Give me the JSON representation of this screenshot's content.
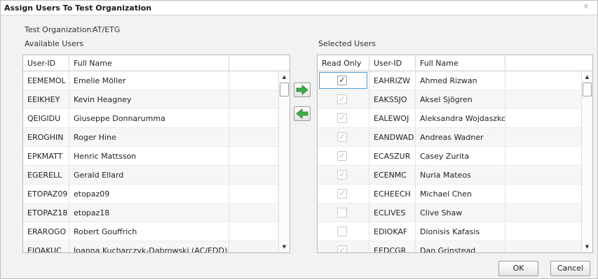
{
  "dialog": {
    "title": "Assign Users To Test Organization",
    "close_glyph": "⨯",
    "org_label": "Test Organization:",
    "org_value": "AT/ETG",
    "available_label": "Available Users",
    "selected_label": "Selected Users"
  },
  "available": {
    "columns": [
      "User-ID",
      "Full Name"
    ],
    "rows": [
      {
        "id": "EEMEMOL",
        "name": "Emelie Möller"
      },
      {
        "id": "EEIKHEY",
        "name": "Kevin Heagney"
      },
      {
        "id": "QEIGIDU",
        "name": "Giuseppe Donnarumma"
      },
      {
        "id": "EROGHIN",
        "name": "Roger Hine"
      },
      {
        "id": "EPKMATT",
        "name": "Henric Mattsson"
      },
      {
        "id": "EGERELL",
        "name": "Gerald Ellard"
      },
      {
        "id": "ETOPAZ09",
        "name": "etopaz09"
      },
      {
        "id": "ETOPAZ18",
        "name": "etopaz18"
      },
      {
        "id": "ERAROGO",
        "name": "Robert Gouffrich"
      },
      {
        "id": "EJOAKUC",
        "name": "Joanna Kucharczyk-Dabrowski (AC/EDD)"
      }
    ]
  },
  "selected": {
    "columns": [
      "Read Only",
      "User-ID",
      "Full Name"
    ],
    "rows": [
      {
        "id": "EAHRIZW",
        "name": "Ahmed Rizwan",
        "read_only": true
      },
      {
        "id": "EAKSSJO",
        "name": "Aksel Sjögren",
        "read_only": true
      },
      {
        "id": "EALEWOJ",
        "name": "Aleksandra Wojdaszko",
        "read_only": true
      },
      {
        "id": "EANDWAD",
        "name": "Andreas Wadner",
        "read_only": true
      },
      {
        "id": "ECASZUR",
        "name": "Casey Zurita",
        "read_only": true
      },
      {
        "id": "ECENMC",
        "name": "Nuria Mateos",
        "read_only": true
      },
      {
        "id": "ECHEECH",
        "name": "Michael Chen",
        "read_only": true
      },
      {
        "id": "ECLIVES",
        "name": "Clive Shaw",
        "read_only": false
      },
      {
        "id": "EDIOKAF",
        "name": "Dionisis Kafasis",
        "read_only": false
      },
      {
        "id": "EEDCGR",
        "name": "Dan Grinstead",
        "read_only": true
      }
    ]
  },
  "icons": {
    "move_right": "green-arrow-right-icon",
    "move_left": "green-arrow-left-icon",
    "arrow_color": "#3cb043"
  },
  "buttons": {
    "ok": "OK",
    "cancel": "Cancel"
  }
}
